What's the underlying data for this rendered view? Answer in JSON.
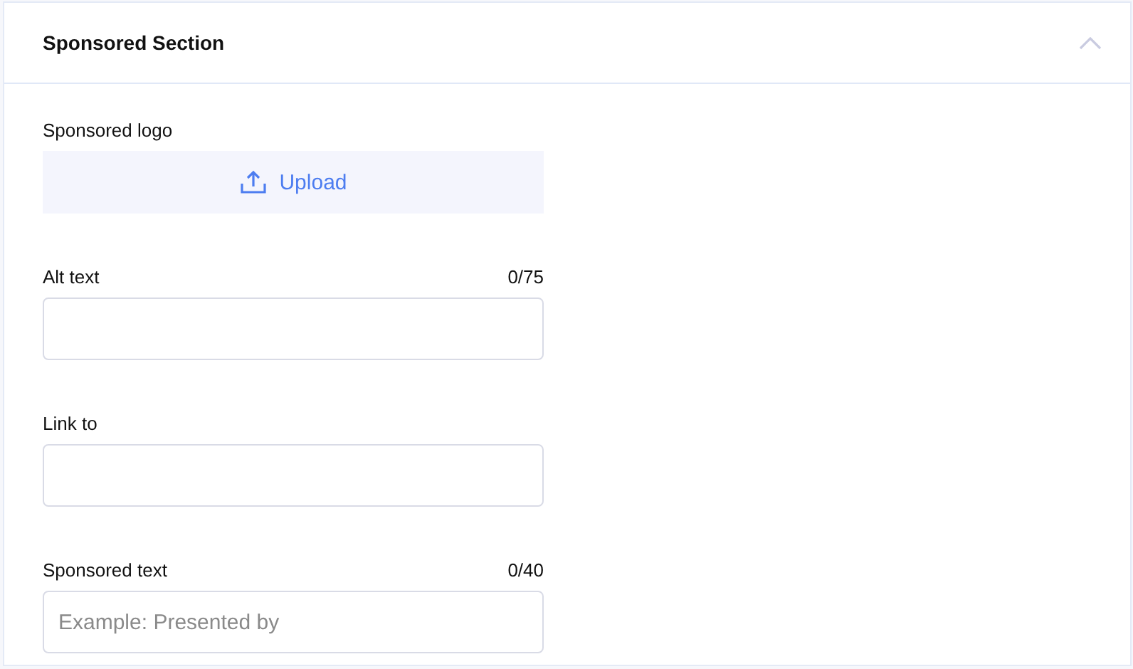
{
  "section": {
    "title": "Sponsored Section",
    "expanded": true
  },
  "fields": [
    {
      "kind": "upload",
      "label": "Sponsored logo",
      "button": "Upload"
    },
    {
      "kind": "text",
      "label": "Alt text",
      "counter": "0/75"
    },
    {
      "kind": "text",
      "label": "Link to"
    },
    {
      "kind": "text",
      "label": "Sponsored text",
      "counter": "0/40",
      "placeholder": "Example: Presented by"
    }
  ]
}
